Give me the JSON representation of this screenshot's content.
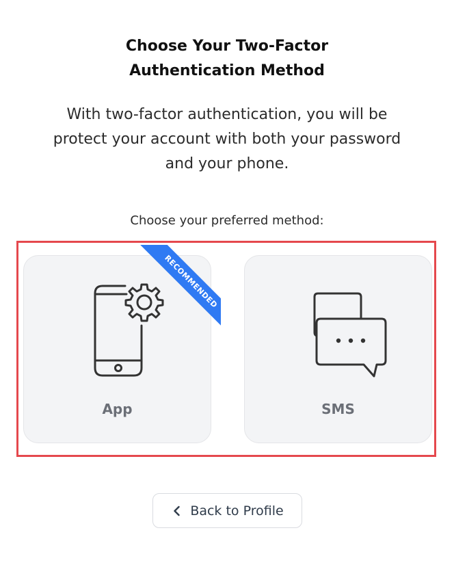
{
  "header": {
    "title_line1": "Choose Your Two-Factor",
    "title_line2": "Authentication Method"
  },
  "description": {
    "line1": "With two-factor authentication, you will be",
    "line2": "protect your account with both your password",
    "line3": "and your phone."
  },
  "prompt": "Choose your preferred method:",
  "methods": [
    {
      "label": "App",
      "icon": "phone-gear-icon",
      "badge": "RECOMMENDED"
    },
    {
      "label": "SMS",
      "icon": "chat-bubbles-icon"
    }
  ],
  "back_button": {
    "label": "Back to Profile",
    "icon": "chevron-left-icon"
  },
  "colors": {
    "highlight": "#e5484d",
    "ribbon": "#2f7af3",
    "card_bg": "#f3f4f6"
  }
}
